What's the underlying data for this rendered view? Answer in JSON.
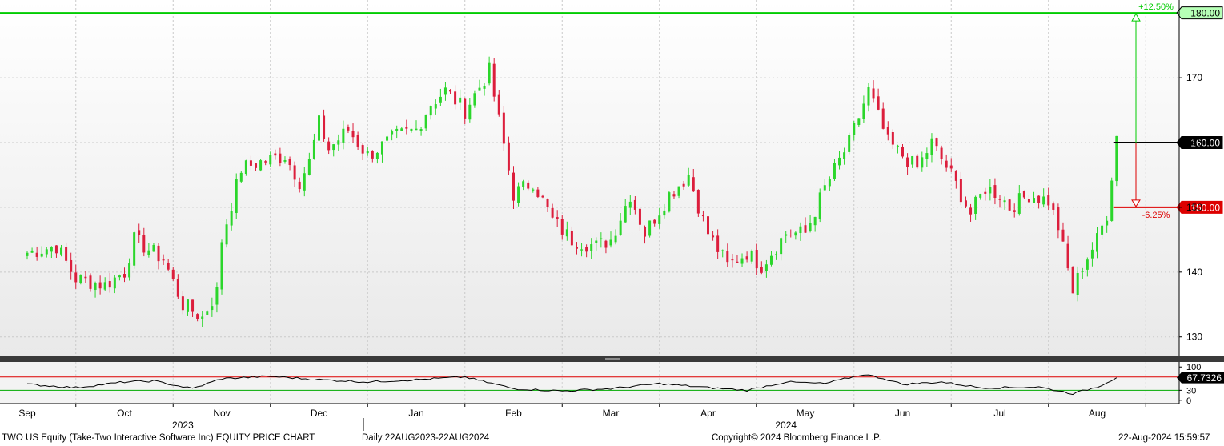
{
  "footer": {
    "title": "TWO US Equity (Take-Two Interactive Software Inc) EQUITY PRICE CHART",
    "period": "Daily 22AUG2023-22AUG2024",
    "copyright": "Copyright© 2024 Bloomberg Finance L.P.",
    "timestamp": "22-Aug-2024 15:59:57"
  },
  "colors": {
    "up": "#2bd62b",
    "down": "#dc1e3c",
    "target_line": "#00cc00",
    "stop_line": "#dd0000",
    "rsi_line": "#000000",
    "rsi_upper_band": "#dd0000",
    "rsi_lower_band": "#00aa00"
  },
  "chart_data": [
    {
      "type": "candlestick",
      "ylim": [
        127,
        182
      ],
      "yticks": [
        130,
        140,
        150,
        160,
        170
      ],
      "grid": true,
      "x_month_labels": [
        "Sep",
        "Oct",
        "Nov",
        "Dec",
        "Jan",
        "Feb",
        "Mar",
        "Apr",
        "May",
        "Jun",
        "Jul",
        "Aug"
      ],
      "x_year_labels": [
        "2023",
        "2024"
      ],
      "anchors": [
        {
          "label": "Sep",
          "month": 0.0,
          "value": 143
        },
        {
          "label": "",
          "month": 0.3,
          "value": 144
        },
        {
          "label": "",
          "month": 0.5,
          "value": 139
        },
        {
          "label": "",
          "month": 0.8,
          "value": 138
        },
        {
          "label": "Oct",
          "month": 1.0,
          "value": 140
        },
        {
          "label": "",
          "month": 1.1,
          "value": 145
        },
        {
          "label": "",
          "month": 1.4,
          "value": 142
        },
        {
          "label": "",
          "month": 1.6,
          "value": 135
        },
        {
          "label": "",
          "month": 1.8,
          "value": 133
        },
        {
          "label": "",
          "month": 1.95,
          "value": 137
        },
        {
          "label": "Nov",
          "month": 2.0,
          "value": 145
        },
        {
          "label": "",
          "month": 2.2,
          "value": 156
        },
        {
          "label": "",
          "month": 2.4,
          "value": 157
        },
        {
          "label": "",
          "month": 2.65,
          "value": 158
        },
        {
          "label": "",
          "month": 2.8,
          "value": 154
        },
        {
          "label": "",
          "month": 2.9,
          "value": 157
        },
        {
          "label": "Dec",
          "month": 3.0,
          "value": 163
        },
        {
          "label": "",
          "month": 3.1,
          "value": 159
        },
        {
          "label": "",
          "month": 3.3,
          "value": 162
        },
        {
          "label": "",
          "month": 3.5,
          "value": 158
        },
        {
          "label": "",
          "month": 3.8,
          "value": 161
        },
        {
          "label": "Jan",
          "month": 4.0,
          "value": 162
        },
        {
          "label": "",
          "month": 4.15,
          "value": 166
        },
        {
          "label": "",
          "month": 4.3,
          "value": 168
        },
        {
          "label": "",
          "month": 4.5,
          "value": 165
        },
        {
          "label": "",
          "month": 4.75,
          "value": 171
        },
        {
          "label": "Feb",
          "month": 5.0,
          "value": 152
        },
        {
          "label": "",
          "month": 5.2,
          "value": 154
        },
        {
          "label": "",
          "month": 5.4,
          "value": 148
        },
        {
          "label": "",
          "month": 5.6,
          "value": 145
        },
        {
          "label": "",
          "month": 5.85,
          "value": 144
        },
        {
          "label": "Mar",
          "month": 6.0,
          "value": 145
        },
        {
          "label": "",
          "month": 6.2,
          "value": 152
        },
        {
          "label": "",
          "month": 6.35,
          "value": 146
        },
        {
          "label": "",
          "month": 6.6,
          "value": 152
        },
        {
          "label": "",
          "month": 6.8,
          "value": 155
        },
        {
          "label": "",
          "month": 6.95,
          "value": 148
        },
        {
          "label": "Apr",
          "month": 7.0,
          "value": 146
        },
        {
          "label": "",
          "month": 7.2,
          "value": 141
        },
        {
          "label": "",
          "month": 7.4,
          "value": 143
        },
        {
          "label": "",
          "month": 7.55,
          "value": 141
        },
        {
          "label": "",
          "month": 7.8,
          "value": 146
        },
        {
          "label": "May",
          "month": 8.0,
          "value": 146
        },
        {
          "label": "",
          "month": 8.2,
          "value": 153
        },
        {
          "label": "",
          "month": 8.45,
          "value": 160
        },
        {
          "label": "",
          "month": 8.65,
          "value": 168
        },
        {
          "label": "",
          "month": 8.85,
          "value": 160
        },
        {
          "label": "Jun",
          "month": 9.0,
          "value": 158
        },
        {
          "label": "",
          "month": 9.15,
          "value": 156
        },
        {
          "label": "",
          "month": 9.3,
          "value": 160
        },
        {
          "label": "",
          "month": 9.5,
          "value": 155
        },
        {
          "label": "",
          "month": 9.7,
          "value": 149
        },
        {
          "label": "",
          "month": 9.85,
          "value": 153
        },
        {
          "label": "Jul",
          "month": 10.0,
          "value": 152
        },
        {
          "label": "",
          "month": 10.1,
          "value": 150
        },
        {
          "label": "",
          "month": 10.3,
          "value": 152
        },
        {
          "label": "",
          "month": 10.5,
          "value": 151
        },
        {
          "label": "",
          "month": 10.6,
          "value": 147
        },
        {
          "label": "",
          "month": 10.75,
          "value": 137
        },
        {
          "label": "",
          "month": 10.85,
          "value": 141
        },
        {
          "label": "",
          "month": 11.0,
          "value": 145
        },
        {
          "label": "Aug",
          "month": 11.1,
          "value": 149
        },
        {
          "label": "",
          "month": 11.15,
          "value": 155
        },
        {
          "label": "",
          "month": 11.2,
          "value": 161
        }
      ],
      "levels": [
        {
          "value": 180,
          "label": "180.00",
          "pct": "+12.50%",
          "role": "target"
        },
        {
          "value": 160,
          "label": "160.00",
          "role": "last"
        },
        {
          "value": 150,
          "label": "150.00",
          "pct": "-6.25%",
          "role": "stop"
        }
      ]
    },
    {
      "type": "line",
      "ylim": [
        -10,
        115
      ],
      "yticks": [
        0,
        30,
        100
      ],
      "tick_labels": [
        "0",
        "30",
        "100"
      ],
      "bands": [
        70,
        30
      ],
      "last_value_label": "67.7326",
      "points": [
        {
          "month": 0.0,
          "value": 48
        },
        {
          "month": 0.5,
          "value": 38
        },
        {
          "month": 1.0,
          "value": 55
        },
        {
          "month": 1.3,
          "value": 58
        },
        {
          "month": 1.7,
          "value": 35
        },
        {
          "month": 2.0,
          "value": 65
        },
        {
          "month": 2.5,
          "value": 72
        },
        {
          "month": 3.0,
          "value": 62
        },
        {
          "month": 3.5,
          "value": 55
        },
        {
          "month": 4.0,
          "value": 62
        },
        {
          "month": 4.5,
          "value": 70
        },
        {
          "month": 5.0,
          "value": 35
        },
        {
          "month": 5.5,
          "value": 28
        },
        {
          "month": 6.0,
          "value": 35
        },
        {
          "month": 6.5,
          "value": 50
        },
        {
          "month": 7.0,
          "value": 38
        },
        {
          "month": 7.4,
          "value": 30
        },
        {
          "month": 7.8,
          "value": 55
        },
        {
          "month": 8.2,
          "value": 50
        },
        {
          "month": 8.6,
          "value": 78
        },
        {
          "month": 8.8,
          "value": 66
        },
        {
          "month": 9.0,
          "value": 48
        },
        {
          "month": 9.4,
          "value": 55
        },
        {
          "month": 9.8,
          "value": 38
        },
        {
          "month": 10.0,
          "value": 38
        },
        {
          "month": 10.4,
          "value": 40
        },
        {
          "month": 10.75,
          "value": 20
        },
        {
          "month": 11.0,
          "value": 40
        },
        {
          "month": 11.2,
          "value": 67.7
        }
      ]
    }
  ]
}
